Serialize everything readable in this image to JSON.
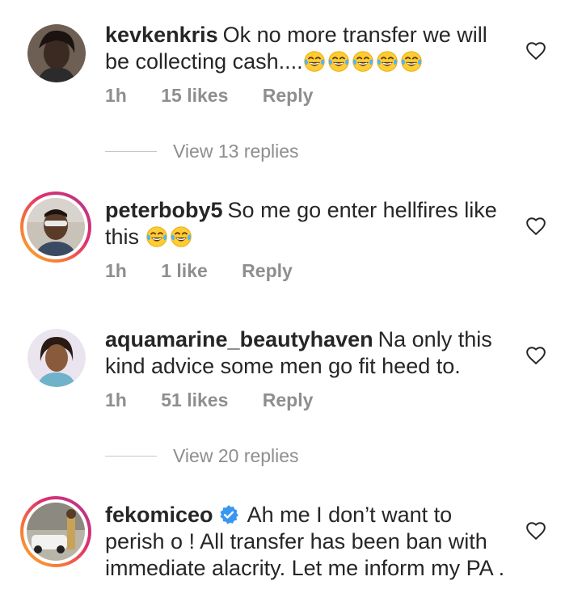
{
  "comments": [
    {
      "username": "kevkenkris",
      "text": "Ok no more transfer we will be collecting cash....",
      "emoji_count": 5,
      "time": "1h",
      "likes": "15 likes",
      "reply": "Reply",
      "view_replies": "View 13 replies"
    },
    {
      "username": "peterboby5",
      "text": "So me go enter hellfires like this",
      "emoji_count": 2,
      "time": "1h",
      "likes": "1 like",
      "reply": "Reply"
    },
    {
      "username": "aquamarine_beautyhaven",
      "text": "Na only this kind advice some men go fit heed to.",
      "time": "1h",
      "likes": "51 likes",
      "reply": "Reply",
      "view_replies": "View 20 replies"
    },
    {
      "username": "fekomiceo",
      "verified": true,
      "text": "Ah me I don’t want to perish o ! All transfer has been ban with immediate alacrity. Let me inform my PA ."
    }
  ],
  "colors": {
    "text": "#262626",
    "secondary": "#8e8e8e",
    "verified": "#3897f0",
    "story_ring_start": "#f9b233",
    "story_ring_end": "#833ab4"
  },
  "icons": {
    "like": "heart-outline-icon",
    "verified": "verified-badge-icon",
    "emoji": "tears-of-joy-emoji"
  }
}
